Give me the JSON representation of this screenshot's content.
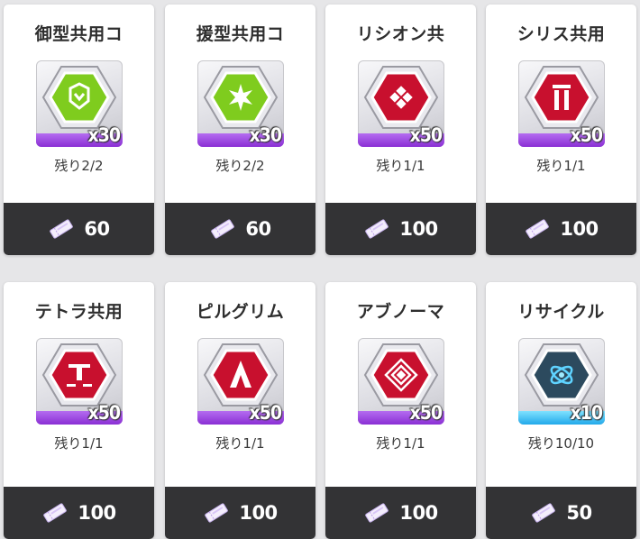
{
  "shop_items": [
    {
      "title": "御型共用コ",
      "icon": "shield-chevron-icon",
      "badge_color": "#7fcc1e",
      "rarity_color": "#8a2fd4",
      "quantity": "x30",
      "remaining": "残り2/2",
      "price": "60"
    },
    {
      "title": "援型共用コ",
      "icon": "spark-star-icon",
      "badge_color": "#7fcc1e",
      "rarity_color": "#8a2fd4",
      "quantity": "x30",
      "remaining": "残り2/2",
      "price": "60"
    },
    {
      "title": "リシオン共",
      "icon": "diamond-grid-icon",
      "badge_color": "#c8102e",
      "rarity_color": "#8a2fd4",
      "quantity": "x50",
      "remaining": "残り1/1",
      "price": "100"
    },
    {
      "title": "シリス共用",
      "icon": "gate-arch-icon",
      "badge_color": "#c8102e",
      "rarity_color": "#8a2fd4",
      "quantity": "x50",
      "remaining": "残り1/1",
      "price": "100"
    },
    {
      "title": "テトラ共用",
      "icon": "t-mark-icon",
      "badge_color": "#c8102e",
      "rarity_color": "#8a2fd4",
      "quantity": "x50",
      "remaining": "残り1/1",
      "price": "100"
    },
    {
      "title": "ピルグリム",
      "icon": "a-emblem-icon",
      "badge_color": "#c8102e",
      "rarity_color": "#8a2fd4",
      "quantity": "x50",
      "remaining": "残り1/1",
      "price": "100"
    },
    {
      "title": "アブノーマ",
      "icon": "nested-diamond-icon",
      "badge_color": "#c8102e",
      "rarity_color": "#8a2fd4",
      "quantity": "x50",
      "remaining": "残り1/1",
      "price": "100"
    },
    {
      "title": "リサイクル",
      "icon": "atom-orbit-icon",
      "badge_color": "#2c4a5e",
      "rarity_color": "#22a9ea",
      "quantity": "x10",
      "remaining": "残り10/10",
      "price": "50"
    }
  ],
  "currency_icon": "ticket-icon"
}
